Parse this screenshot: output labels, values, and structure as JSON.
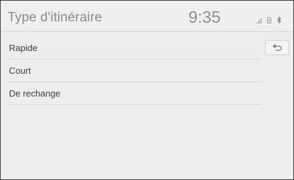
{
  "header": {
    "title": "Type d'itinéraire",
    "clock": "9:35",
    "status_icons": [
      "signal-icon",
      "phone-icon",
      "bluetooth-icon"
    ],
    "bluetooth_glyph": "ʙ"
  },
  "routes": [
    {
      "label": "Rapide"
    },
    {
      "label": "Court"
    },
    {
      "label": "De rechange"
    }
  ],
  "back_button": {
    "icon": "back-arrow-icon"
  }
}
